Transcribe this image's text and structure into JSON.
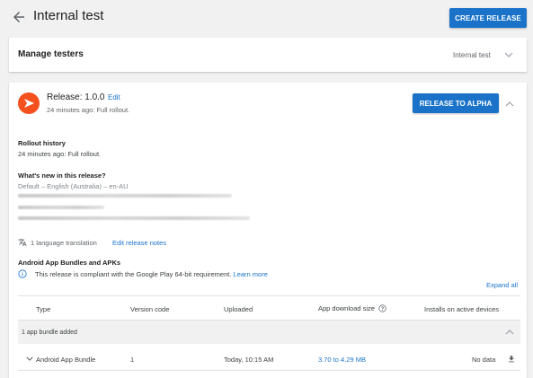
{
  "header": {
    "title": "Internal test",
    "create_release_label": "CREATE RELEASE"
  },
  "testers": {
    "title": "Manage testers",
    "track_label": "Internal test"
  },
  "release": {
    "name": "Release: 1.0.0",
    "edit_label": "Edit",
    "subtitle": "24 minutes ago: Full rollout.",
    "promote_label": "RELEASE TO ALPHA",
    "rollout_history_title": "Rollout history",
    "rollout_history_text": "24 minutes ago: Full rollout.",
    "whats_new_title": "What's new in this release?",
    "whats_new_locale": "Default – English (Australia) – en-AU",
    "translation_label": "1 language translation",
    "edit_notes_label": "Edit release notes"
  },
  "bundles": {
    "title": "Android App Bundles and APKs",
    "info_text": "This release is compliant with the Google Play 64-bit requirement.",
    "learn_more_label": "Learn more",
    "expand_all_label": "Expand all",
    "columns": [
      "Type",
      "Version code",
      "Uploaded",
      "App download size",
      "Installs on active devices"
    ],
    "group_label": "1 app bundle added",
    "rows": [
      {
        "type": "Android App Bundle",
        "version_code": "1",
        "uploaded": "Today, 10:15 AM",
        "download_size": "3.70 to 4.29 MB",
        "installs": "No data"
      }
    ]
  },
  "colors": {
    "accent": "#1a73c8",
    "logo_orange": "#f4511e",
    "background": "#f1f1f1"
  },
  "icons": {
    "back": "arrow-back-icon",
    "chevron_down": "chevron-down-icon",
    "chevron_up": "chevron-up-icon",
    "translate": "translate-icon",
    "info": "info-icon",
    "help": "help-circle-icon",
    "download": "download-icon"
  }
}
